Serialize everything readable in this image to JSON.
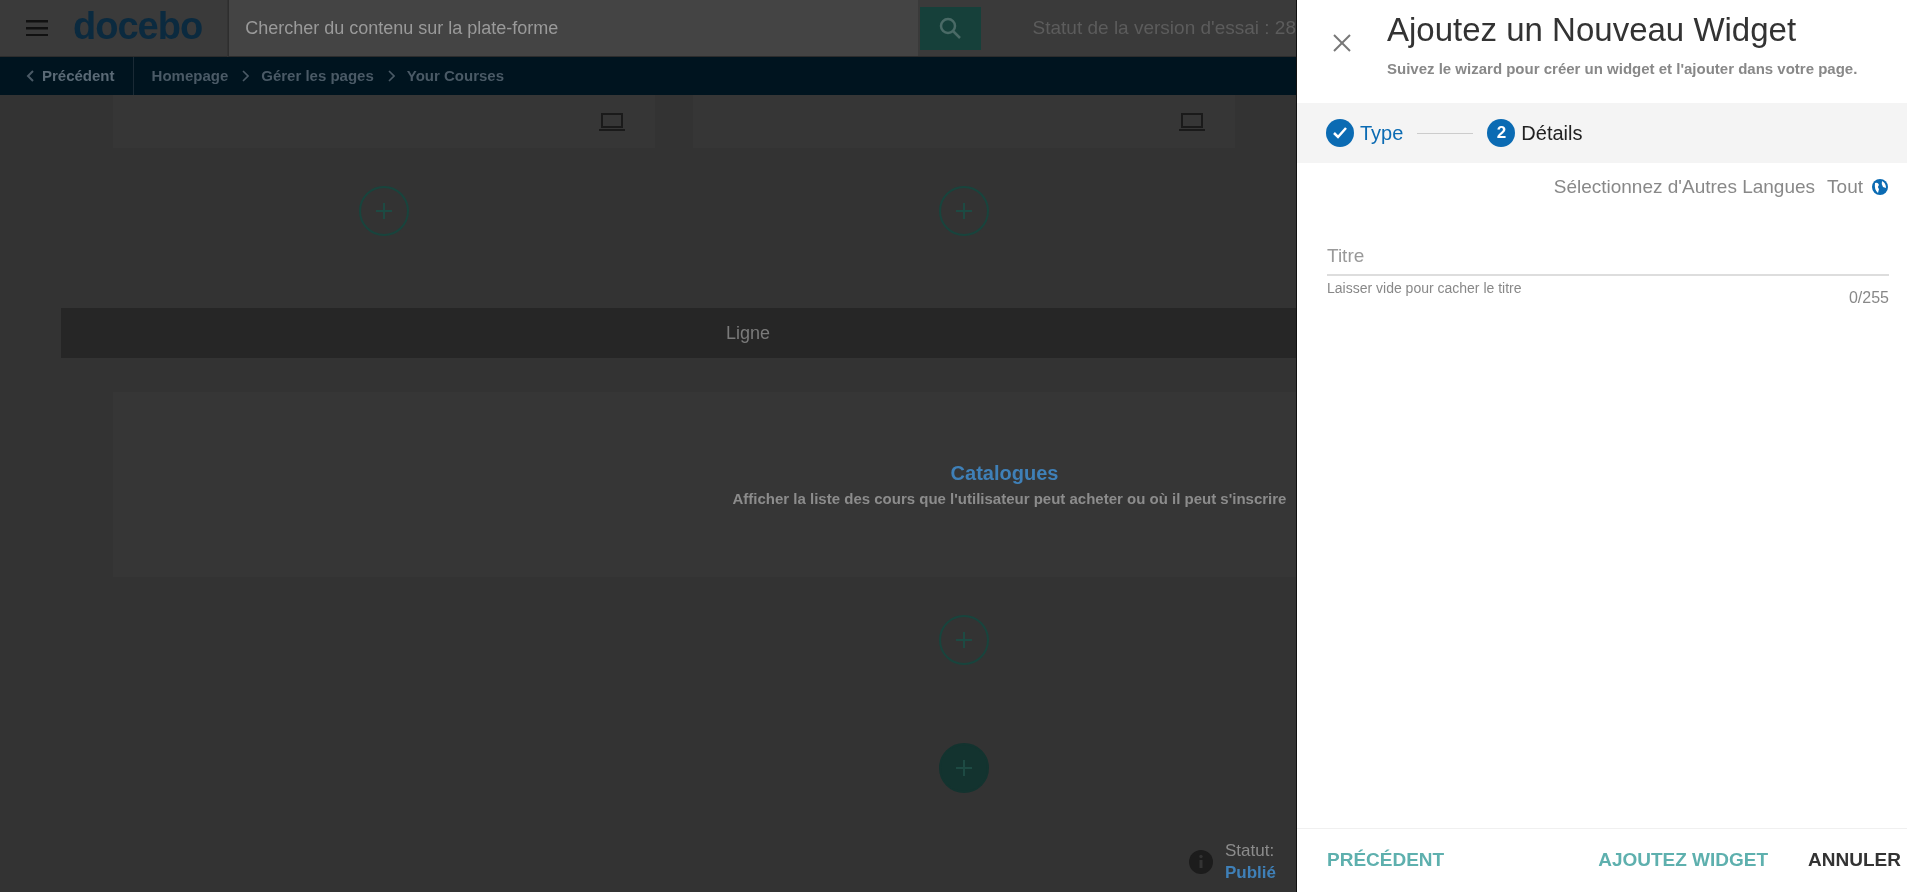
{
  "header": {
    "logo": "docebo",
    "search": {
      "placeholder": "Chercher du contenu sur la plate-forme"
    },
    "trial_status": "Statut de la version d'essai : 28"
  },
  "breadcrumb": {
    "back": "Précédent",
    "items": [
      "Homepage",
      "Gérer les pages",
      "Your Courses"
    ]
  },
  "row_label": "Ligne",
  "widget": {
    "title": "Catalogues",
    "description": "Afficher la liste des cours que l'utilisateur peut acheter ou où il peut s'inscrire"
  },
  "page_status": {
    "label": "Statut:",
    "value": "Publié"
  },
  "panel": {
    "title": "Ajoutez un Nouveau Widget",
    "subtitle": "Suivez le wizard pour créer un widget et l'ajouter dans votre page.",
    "steps": [
      {
        "label": "Type",
        "done": true
      },
      {
        "label": "Détails",
        "number": "2",
        "done": false
      }
    ],
    "languages": {
      "label": "Sélectionnez d'Autres Langues",
      "value": "Tout"
    },
    "title_field": {
      "placeholder": "Titre",
      "hint": "Laisser vide pour cacher le titre",
      "counter": "0/255"
    },
    "buttons": [
      {
        "label": "PRÉCÉDENT",
        "kind": "back"
      },
      {
        "label": "AJOUTEZ WIDGET",
        "kind": "primary"
      },
      {
        "label": "ANNULER",
        "kind": "cancel"
      }
    ]
  }
}
